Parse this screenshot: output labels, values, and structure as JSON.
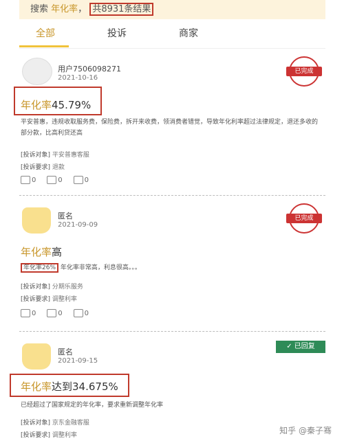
{
  "search": {
    "prefix": "搜索",
    "keyword": "年化率",
    "sep": "，",
    "count": "共8931条结果"
  },
  "tabs": [
    {
      "label": "全部"
    },
    {
      "label": "投诉"
    },
    {
      "label": "商家"
    }
  ],
  "posts": [
    {
      "user": "用户7506098271",
      "date": "2021-10-16",
      "status": "已完成",
      "title_kw": "年化率",
      "title_rest": "45.79%",
      "body": "平安普惠，违规收取服务费，保险费，拆开来收费，领消费者错觉，导致年化利率超过法律规定，退还多收的部分款，比高利贷还高",
      "target_label": "[投诉对象]",
      "target": "平安普惠客服",
      "request_label": "[投诉要求]",
      "request": "退款",
      "likes": "0",
      "comments": "0",
      "shares": "0"
    },
    {
      "user": "匿名",
      "date": "2021-09-09",
      "status": "已完成",
      "title_kw": "年化率",
      "title_rest": "高",
      "body_hl": "年化率26%",
      "body": "年化率非常高，利息很高。。。",
      "target_label": "[投诉对象]",
      "target": "分期乐服务",
      "request_label": "[投诉要求]",
      "request": "调整利率",
      "likes": "0",
      "comments": "0",
      "shares": "0"
    },
    {
      "user": "匿名",
      "date": "2021-09-15",
      "status": "已回复",
      "title_kw": "年化率",
      "title_rest": "达到34.675%",
      "body": "已经超过了国家规定的年化率，要求重新调整年化率",
      "target_label": "[投诉对象]",
      "target": "京东金融客服",
      "request_label": "[投诉要求]",
      "request": "调整利率"
    }
  ],
  "watermark": "知乎 @秦子骞",
  "colors": {
    "accent": "#c8962a",
    "highlight_box": "#c0392b",
    "replied": "#2e8b57",
    "stamp": "#cc3333"
  }
}
